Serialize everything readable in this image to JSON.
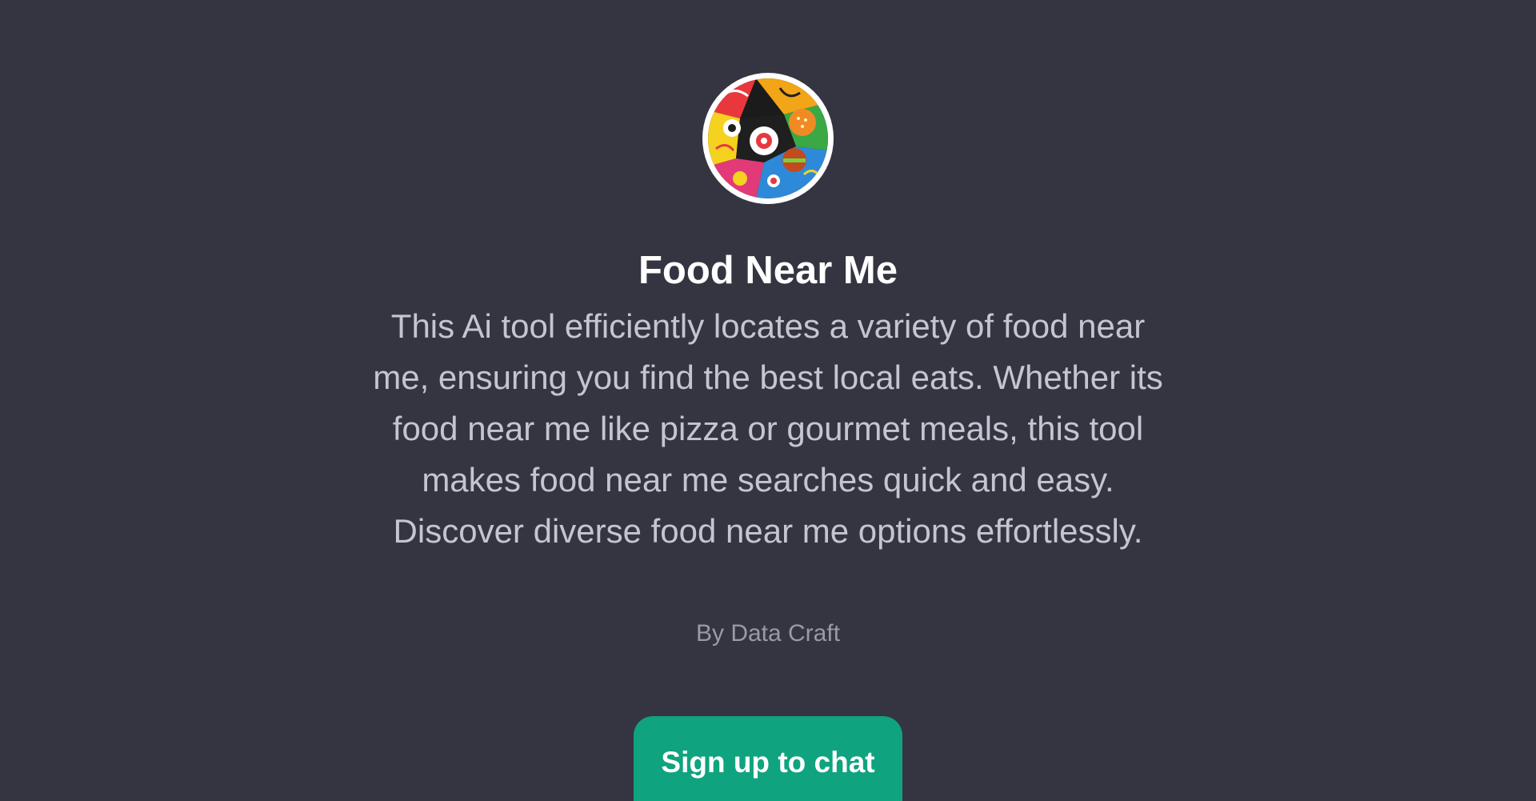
{
  "gpt": {
    "avatar_icon": "food-collage-icon",
    "title": "Food Near Me",
    "description": "This Ai tool efficiently locates a variety of food near me, ensuring you find the best local eats. Whether its food near me like pizza or gourmet meals, this tool makes food near me searches quick and easy. Discover diverse food near me options effortlessly.",
    "author": "By Data Craft"
  },
  "actions": {
    "signup_label": "Sign up to chat"
  },
  "colors": {
    "background": "#343541",
    "title": "#ffffff",
    "description": "#c5c5d2",
    "author": "#9a9aa6",
    "accent": "#10a37f"
  }
}
